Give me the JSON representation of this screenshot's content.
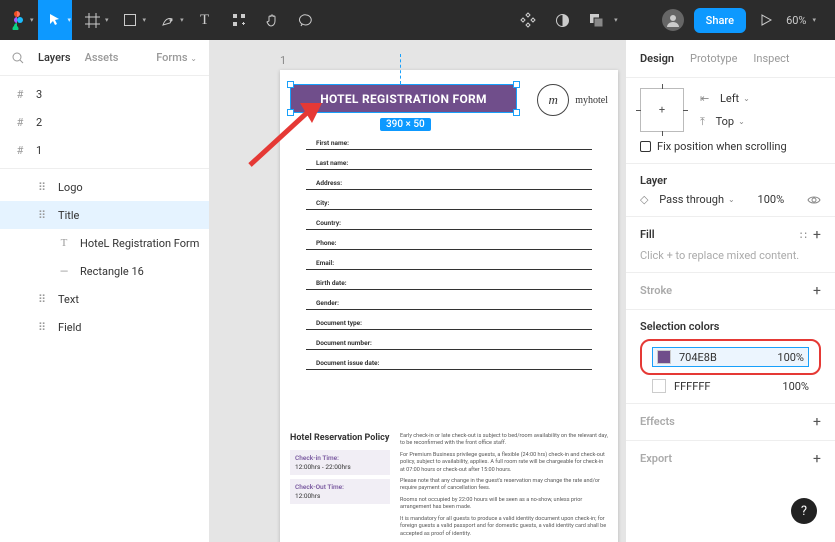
{
  "toolbar": {
    "zoom": "60%",
    "share": "Share"
  },
  "leftPanel": {
    "tabs": {
      "layers": "Layers",
      "assets": "Assets",
      "forms": "Forms"
    },
    "pages": [
      "3",
      "2",
      "1"
    ],
    "tree": [
      {
        "icon": "group",
        "label": "Logo"
      },
      {
        "icon": "group",
        "label": "Title",
        "selected": true
      },
      {
        "icon": "text",
        "label": "HoteL Registration Form",
        "indent": 2
      },
      {
        "icon": "line",
        "label": "Rectangle 16",
        "indent": 2
      },
      {
        "icon": "group",
        "label": "Text"
      },
      {
        "icon": "group",
        "label": "Field"
      }
    ]
  },
  "canvas": {
    "frameLabel": "1",
    "title": "HOTEL REGISTRATION FORM",
    "dimBadge": "390 × 50",
    "brandName": "myhotel",
    "brandMono": "m",
    "fields": [
      "First name:",
      "Last name:",
      "Address:",
      "City:",
      "Country:",
      "Phone:",
      "Email:",
      "Birth date:",
      "Gender:",
      "Document type:",
      "Document number:",
      "Document issue date:"
    ],
    "policy": {
      "title": "Hotel Reservation Policy",
      "checkin": {
        "label": "Check-in Time:",
        "value": "12:00hrs - 22:00hrs"
      },
      "checkout": {
        "label": "Check-Out Time:",
        "value": "12:00hrs"
      },
      "paras": [
        "Early check-in or late check-out is subject to bed/room availability on the relevant day, to be reconfirmed with the front office staff.",
        "For Premium Business privilege guests, a flexible (24:00 hrs) check-in and check-out policy, subject to availability, applies. A full room rate will be chargeable for check-in at 07:00 hours or check-out after 15:00 hours.",
        "Please note that any change in the guest's reservation may change the rate and/or require payment of cancellation fees.",
        "Rooms not occupied by 22:00 hours will be seen as a no-show, unless prior arrangement has been made.",
        "It is mandatory for all guests to produce a valid identity document upon check-in; for foreign guests a valid passport and for domestic guests, a valid identity card shall be accepted as proof of identity."
      ]
    }
  },
  "rightPanel": {
    "tabs": {
      "design": "Design",
      "prototype": "Prototype",
      "inspect": "Inspect"
    },
    "constraints": {
      "left": "Left",
      "top": "Top"
    },
    "pin": "Fix position when scrolling",
    "layer": {
      "title": "Layer",
      "mode": "Pass through",
      "pct": "100%"
    },
    "fill": {
      "title": "Fill",
      "hint": "Click + to replace mixed content."
    },
    "stroke": {
      "title": "Stroke"
    },
    "selColors": {
      "title": "Selection colors",
      "items": [
        {
          "hex": "704E8B",
          "pct": "100%",
          "swatch": "#704E8B"
        },
        {
          "hex": "FFFFFF",
          "pct": "100%",
          "swatch": "#FFFFFF"
        }
      ]
    },
    "effects": "Effects",
    "export": "Export"
  },
  "help": "?"
}
